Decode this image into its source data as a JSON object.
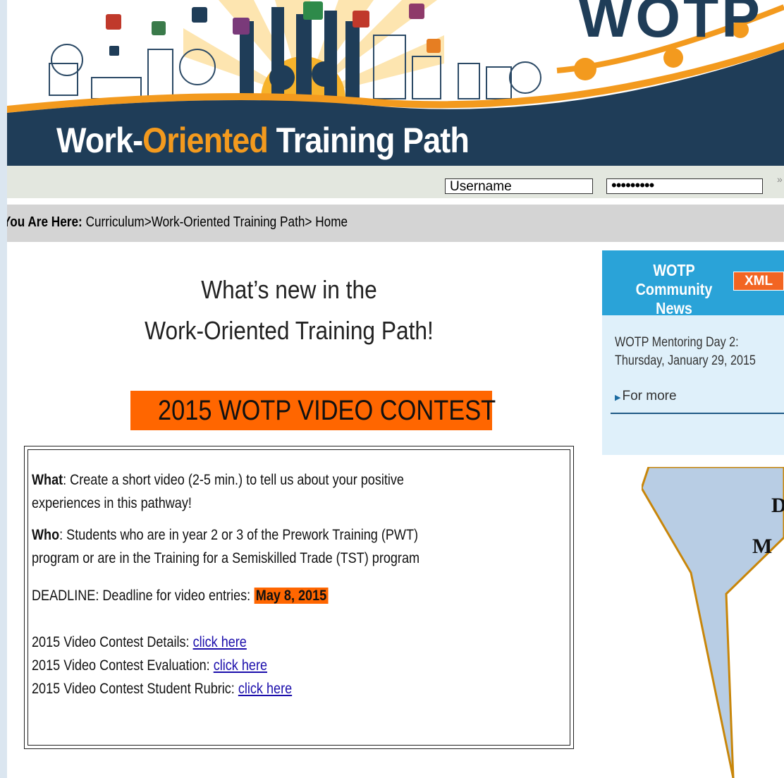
{
  "banner": {
    "title_part1": "Work-",
    "title_part2": "Oriented",
    "title_part3": " Training Path",
    "logo": "WOTP",
    "colors": {
      "navy": "#1f3d58",
      "orange": "#f39a1e",
      "gold": "#f7b32b"
    }
  },
  "login": {
    "username_value": "Username",
    "password_value": "•••••••••",
    "go_symbol": "»"
  },
  "breadcrumb": {
    "label": "You Are Here:",
    "path": " Curriculum>Work-Oriented Training Path> Home"
  },
  "main": {
    "headline_line1": "What’s new in the",
    "headline_line2": "Work-Oriented Training Path!",
    "contest_title": "2015 WOTP VIDEO CONTEST",
    "what_label": "What",
    "what_text_1": ": Create a short video (2-5 min.) to tell us about your positive",
    "what_text_2": "experiences in this pathway!",
    "who_label": "Who",
    "who_text_1": ": Students who are in year 2 or 3 of the Prework Training (PWT)",
    "who_text_2": "program or are in the Training for a Semiskilled Trade (TST) program",
    "deadline_label": "DEADLINE",
    "deadline_text": ": Deadline for video entries: ",
    "deadline_date": "May 8, 2015",
    "links": [
      {
        "label": "2015 Video Contest Details: ",
        "link_text": "click here"
      },
      {
        "label": "2015 Video Contest Evaluation: ",
        "link_text": "click here"
      },
      {
        "label": "2015 Video Contest Student Rubric: ",
        "link_text": "click here"
      }
    ]
  },
  "news": {
    "title_line1": "WOTP Community",
    "title_line2": "News",
    "xml_badge": "XML",
    "item_line1": "WOTP Mentoring Day 2:",
    "item_line2": "Thursday, January 29, 2015",
    "for_more": "For more"
  },
  "callout": {
    "line1": "D",
    "line2": "M",
    "color": "#b8cde4"
  }
}
